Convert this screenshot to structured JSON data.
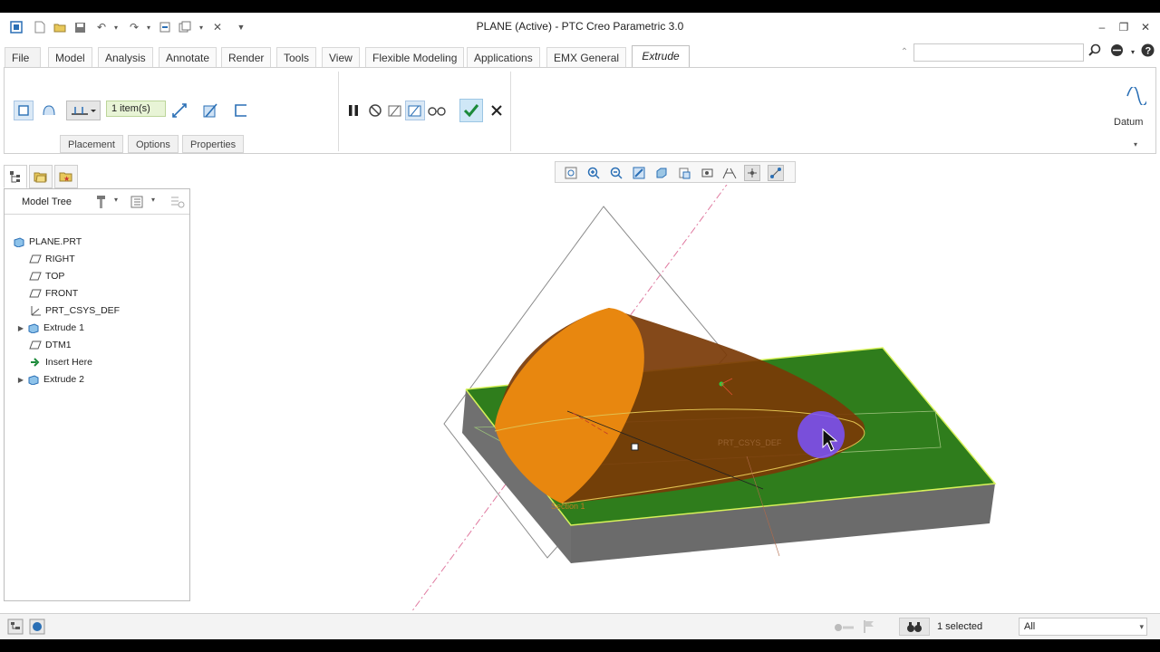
{
  "window": {
    "title": "PLANE (Active) - PTC Creo Parametric 3.0"
  },
  "tabs": [
    {
      "label": "File"
    },
    {
      "label": "Model"
    },
    {
      "label": "Analysis"
    },
    {
      "label": "Annotate"
    },
    {
      "label": "Render"
    },
    {
      "label": "Tools"
    },
    {
      "label": "View"
    },
    {
      "label": "Flexible Modeling"
    },
    {
      "label": "Applications"
    },
    {
      "label": "EMX General"
    },
    {
      "label": "Extrude"
    }
  ],
  "ribbon": {
    "items_field": "1 item(s)",
    "sub_tabs": [
      "Placement",
      "Options",
      "Properties"
    ],
    "datum_label": "Datum"
  },
  "model_tree": {
    "title": "Model Tree",
    "items": [
      {
        "label": "PLANE.PRT",
        "icon": "part-icon"
      },
      {
        "label": "RIGHT",
        "icon": "datum-plane-icon"
      },
      {
        "label": "TOP",
        "icon": "datum-plane-icon"
      },
      {
        "label": "FRONT",
        "icon": "datum-plane-icon"
      },
      {
        "label": "PRT_CSYS_DEF",
        "icon": "csys-icon"
      },
      {
        "label": "Extrude 1",
        "icon": "extrude-icon"
      },
      {
        "label": "DTM1",
        "icon": "datum-plane-icon"
      },
      {
        "label": "Insert Here",
        "icon": "insert-arrow-icon"
      },
      {
        "label": "Extrude 2",
        "icon": "extrude-icon"
      }
    ]
  },
  "viewport": {
    "section_label": "Section 1",
    "csys_label": "PRT_CSYS_DEF"
  },
  "status": {
    "selected": "1 selected",
    "filter": "All"
  },
  "colors": {
    "top_face": "#2f7d1c",
    "side_face": "#6b6b6b",
    "extrude_orange": "#e8870f",
    "extrude_dark": "#7a3a06",
    "highlight_edge": "#d7f25a",
    "cursor_halo": "#7a52ff"
  }
}
